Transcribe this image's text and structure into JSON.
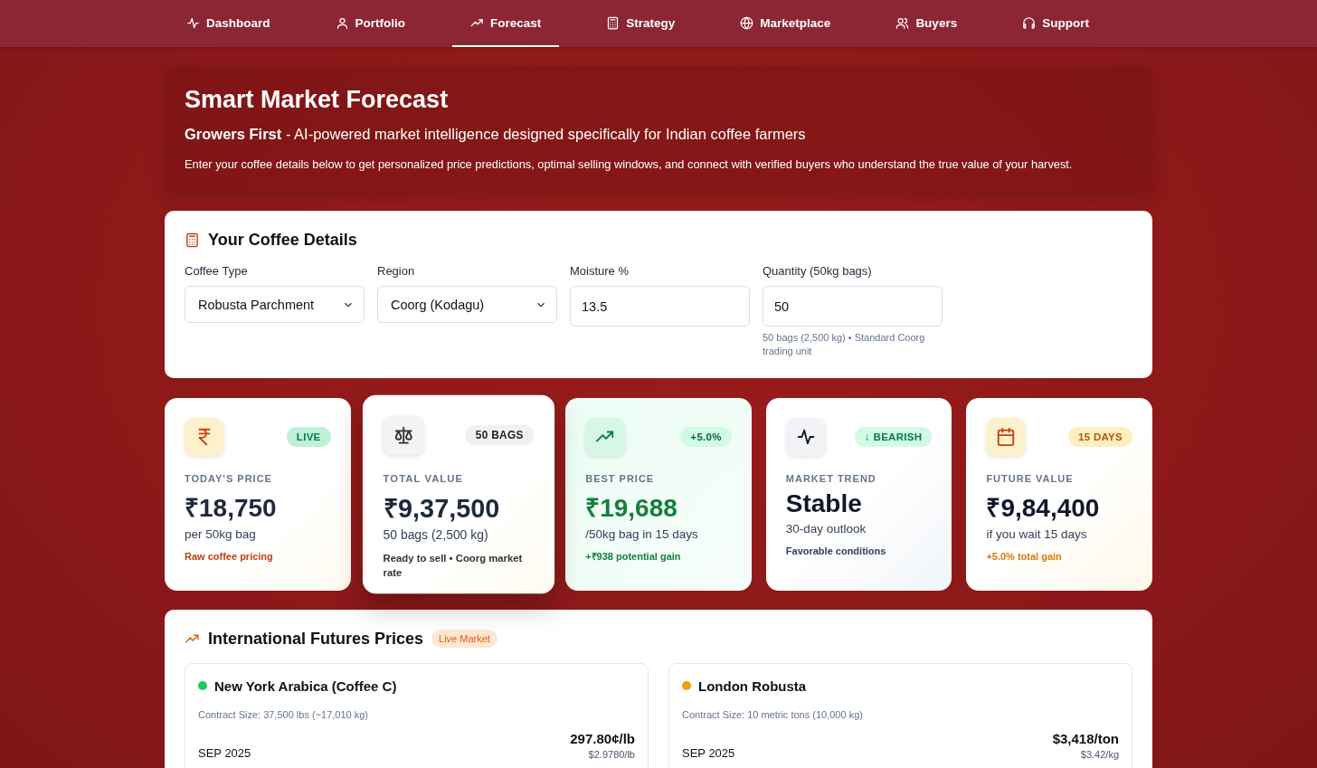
{
  "nav": [
    {
      "label": "Dashboard",
      "kind": "pulse",
      "selected": false
    },
    {
      "label": "Portfolio",
      "kind": "user",
      "selected": false
    },
    {
      "label": "Forecast",
      "kind": "trend",
      "selected": true
    },
    {
      "label": "Strategy",
      "kind": "calculator",
      "selected": false
    },
    {
      "label": "Marketplace",
      "kind": "globe",
      "selected": false
    },
    {
      "label": "Buyers",
      "kind": "users",
      "selected": false
    },
    {
      "label": "Support",
      "kind": "headset",
      "selected": false
    }
  ],
  "hero": {
    "title": "Smart Market Forecast",
    "subtitle": "**Growers First** - AI-powered market intelligence designed specifically for Indian coffee farmers",
    "text": "Enter your coffee details below to get personalized price predictions, optimal selling windows, and connect with verified buyers who understand the true value of your harvest."
  },
  "details": {
    "title": "Your Coffee Details",
    "fields": [
      {
        "kind": "select",
        "label": "Coffee Type",
        "value": "Robusta Parchment"
      },
      {
        "kind": "select",
        "label": "Region",
        "value": "Coorg (Kodagu)"
      },
      {
        "kind": "input",
        "label": "Moisture %",
        "value": "13.5"
      },
      {
        "kind": "input",
        "label": "Quantity (50kg bags)",
        "value": "50",
        "hint": "50 bags (2,500 kg) • Standard Coorg trading unit"
      }
    ]
  },
  "stats": [
    {
      "kind": "rupee",
      "badge": "LIVE",
      "label": "TODAY'S PRICE",
      "value": "₹18,750",
      "sub": "per 50kg bag",
      "note": "Raw coffee pricing",
      "raised": false
    },
    {
      "kind": "scale",
      "badge": "50 BAGS",
      "label": "TOTAL VALUE",
      "value": "₹9,37,500",
      "sub": "50 bags (2,500 kg)",
      "note": "Ready to sell • Coorg market rate",
      "raised": true
    },
    {
      "kind": "trend",
      "badge": "+5.0%",
      "label": "BEST PRICE",
      "value": "₹19,688",
      "sub": "/50kg bag in 15 days",
      "note": "+₹938 potential gain",
      "raised": false
    },
    {
      "kind": "pulse",
      "badge": "↓ BEARISH",
      "label": "MARKET TREND",
      "value": "Stable",
      "sub": "30-day outlook",
      "note": "Favorable conditions",
      "raised": false
    },
    {
      "kind": "calendar",
      "badge": "15 DAYS",
      "label": "FUTURE VALUE",
      "value": "₹9,84,400",
      "sub": "if you wait 15 days",
      "note": "+5.0% total gain",
      "raised": false
    }
  ],
  "futures": {
    "title": "International Futures Prices",
    "badge": "Live Market",
    "markets": [
      {
        "name": "New York Arabica (Coffee C)",
        "color": "#22c55e",
        "contract": "Contract Size: 37,500 lbs (~17,010 kg)",
        "month": "SEP 2025",
        "price": "297.80¢/lb",
        "sub_price": "$2.9780/lb"
      },
      {
        "name": "London Robusta",
        "color": "#f59e0b",
        "contract": "Contract Size: 10 metric tons (10,000 kg)",
        "month": "SEP 2025",
        "price": "$3,418/ton",
        "sub_price": "$3.42/kg"
      }
    ]
  }
}
